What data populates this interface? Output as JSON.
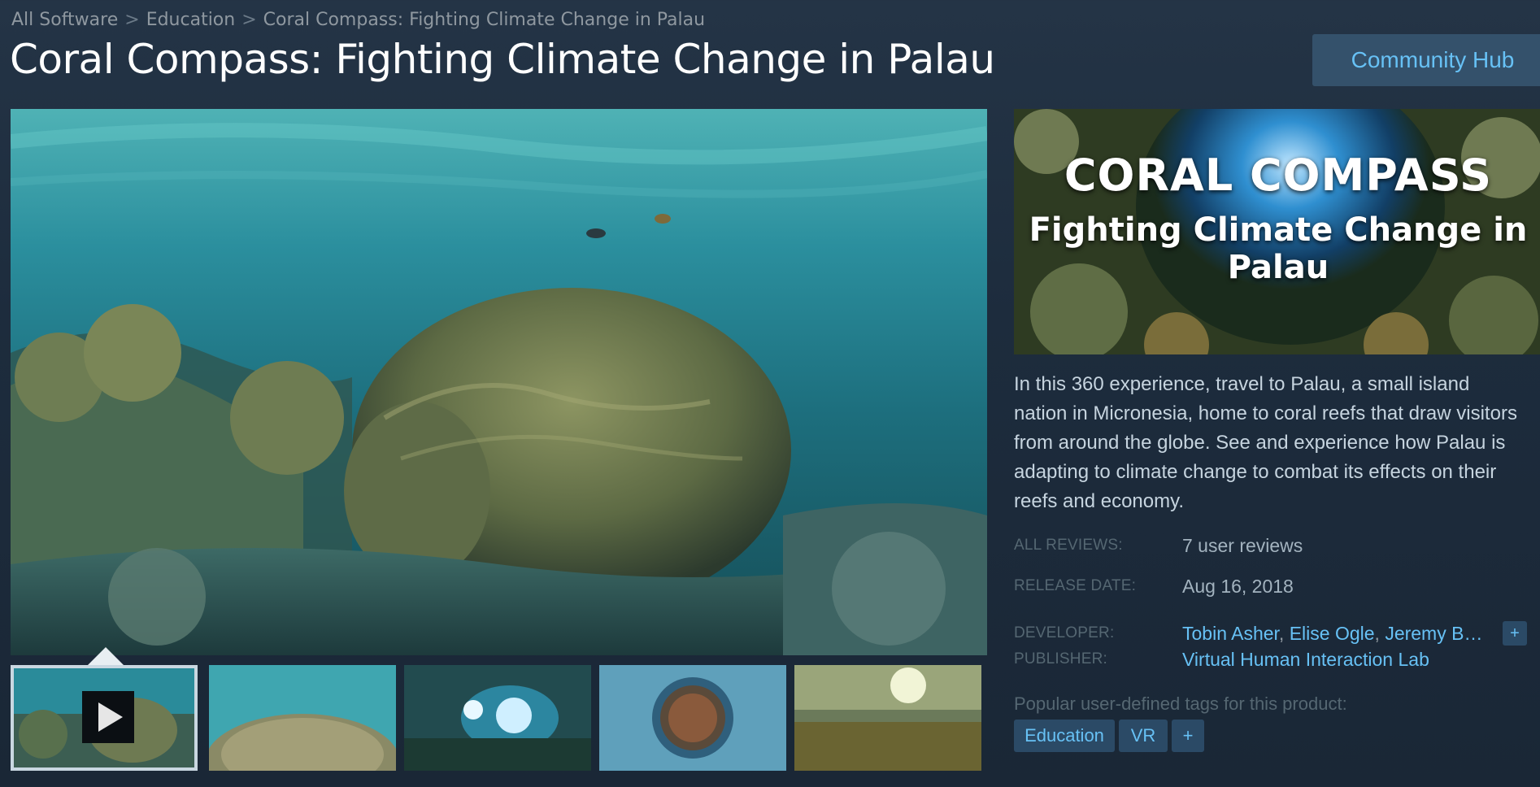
{
  "breadcrumb": {
    "items": [
      "All Software",
      "Education",
      "Coral Compass: Fighting Climate Change in Palau"
    ],
    "separator": ">"
  },
  "page_title": "Coral Compass: Fighting Climate Change in Palau",
  "community_hub_label": "Community Hub",
  "capsule": {
    "title_line1": "CORAL COMPASS",
    "title_line2": "Fighting Climate Change in Palau"
  },
  "description": "In this 360 experience, travel to Palau, a small island nation in Micronesia, home to coral reefs that draw visitors from around the globe. See and experience how Palau is adapting to climate change to combat its effects on their reefs and economy.",
  "info": {
    "reviews_label": "ALL REVIEWS:",
    "reviews_value": "7 user reviews",
    "release_label": "RELEASE DATE:",
    "release_value": "Aug 16, 2018",
    "developer_label": "DEVELOPER:",
    "developers": [
      "Tobin Asher",
      "Elise Ogle",
      "Jeremy B…"
    ],
    "developer_more": "+",
    "publisher_label": "PUBLISHER:",
    "publisher": "Virtual Human Interaction Lab"
  },
  "tags": {
    "label": "Popular user-defined tags for this product:",
    "items": [
      "Education",
      "VR"
    ],
    "more": "+"
  },
  "colors": {
    "accent": "#67c1f5",
    "tag_bg": "#2b4a66",
    "background": "#1b2838"
  },
  "thumbnails": [
    {
      "name": "video-thumb",
      "kind": "video"
    },
    {
      "name": "coral-reef-thumb",
      "kind": "screenshot"
    },
    {
      "name": "underwater-lights-thumb",
      "kind": "screenshot"
    },
    {
      "name": "planet-view-thumb",
      "kind": "screenshot"
    },
    {
      "name": "seafloor-sun-thumb",
      "kind": "screenshot"
    }
  ]
}
